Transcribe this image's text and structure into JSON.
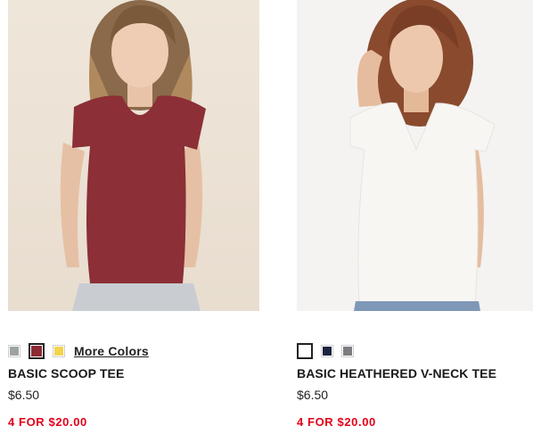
{
  "products": [
    {
      "image_alt": "BASIC SCOOP TEE",
      "swatches": [
        {
          "name": "gray",
          "color": "#9ea3a1",
          "selected": false
        },
        {
          "name": "burgundy",
          "color": "#8c2a34",
          "selected": true
        },
        {
          "name": "yellow",
          "color": "#f2d44e",
          "selected": false
        }
      ],
      "more_colors_label": "More Colors",
      "title": "BASIC SCOOP TEE",
      "price": "$6.50",
      "promo": "4 FOR $20.00",
      "shirt_color": "#8c2f36"
    },
    {
      "image_alt": "BASIC HEATHERED V-NECK TEE",
      "swatches": [
        {
          "name": "white",
          "color": "#ffffff",
          "selected": true
        },
        {
          "name": "navy",
          "color": "#1d2440",
          "selected": false
        },
        {
          "name": "charcoal",
          "color": "#7b7d80",
          "selected": false
        }
      ],
      "title": "BASIC HEATHERED V-NECK TEE",
      "price": "$6.50",
      "promo": "4 FOR $20.00",
      "shirt_color": "#f7f6f3"
    }
  ]
}
